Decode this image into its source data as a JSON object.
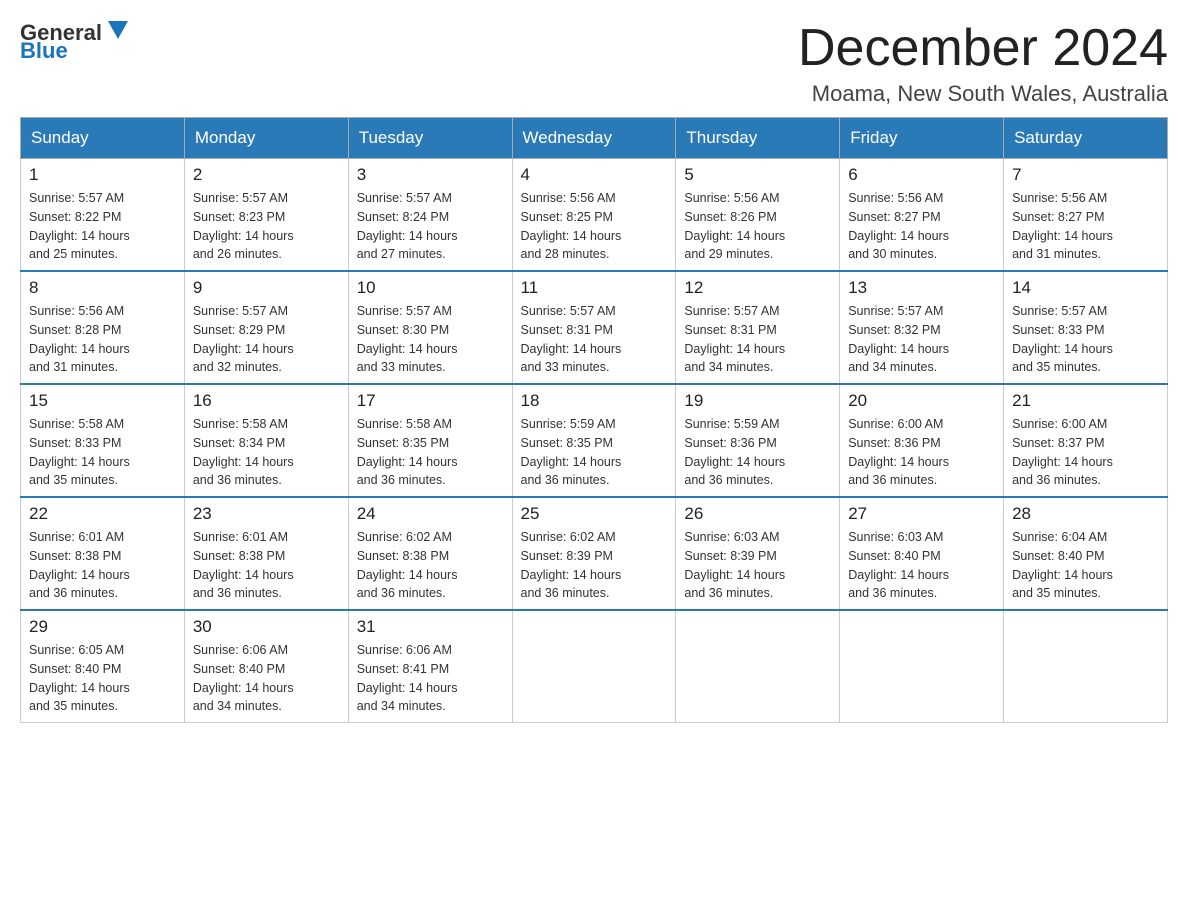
{
  "header": {
    "logo_general": "General",
    "logo_blue": "Blue",
    "month_title": "December 2024",
    "location": "Moama, New South Wales, Australia"
  },
  "days_of_week": [
    "Sunday",
    "Monday",
    "Tuesday",
    "Wednesday",
    "Thursday",
    "Friday",
    "Saturday"
  ],
  "weeks": [
    [
      {
        "day": "1",
        "sunrise": "5:57 AM",
        "sunset": "8:22 PM",
        "daylight": "14 hours and 25 minutes."
      },
      {
        "day": "2",
        "sunrise": "5:57 AM",
        "sunset": "8:23 PM",
        "daylight": "14 hours and 26 minutes."
      },
      {
        "day": "3",
        "sunrise": "5:57 AM",
        "sunset": "8:24 PM",
        "daylight": "14 hours and 27 minutes."
      },
      {
        "day": "4",
        "sunrise": "5:56 AM",
        "sunset": "8:25 PM",
        "daylight": "14 hours and 28 minutes."
      },
      {
        "day": "5",
        "sunrise": "5:56 AM",
        "sunset": "8:26 PM",
        "daylight": "14 hours and 29 minutes."
      },
      {
        "day": "6",
        "sunrise": "5:56 AM",
        "sunset": "8:27 PM",
        "daylight": "14 hours and 30 minutes."
      },
      {
        "day": "7",
        "sunrise": "5:56 AM",
        "sunset": "8:27 PM",
        "daylight": "14 hours and 31 minutes."
      }
    ],
    [
      {
        "day": "8",
        "sunrise": "5:56 AM",
        "sunset": "8:28 PM",
        "daylight": "14 hours and 31 minutes."
      },
      {
        "day": "9",
        "sunrise": "5:57 AM",
        "sunset": "8:29 PM",
        "daylight": "14 hours and 32 minutes."
      },
      {
        "day": "10",
        "sunrise": "5:57 AM",
        "sunset": "8:30 PM",
        "daylight": "14 hours and 33 minutes."
      },
      {
        "day": "11",
        "sunrise": "5:57 AM",
        "sunset": "8:31 PM",
        "daylight": "14 hours and 33 minutes."
      },
      {
        "day": "12",
        "sunrise": "5:57 AM",
        "sunset": "8:31 PM",
        "daylight": "14 hours and 34 minutes."
      },
      {
        "day": "13",
        "sunrise": "5:57 AM",
        "sunset": "8:32 PM",
        "daylight": "14 hours and 34 minutes."
      },
      {
        "day": "14",
        "sunrise": "5:57 AM",
        "sunset": "8:33 PM",
        "daylight": "14 hours and 35 minutes."
      }
    ],
    [
      {
        "day": "15",
        "sunrise": "5:58 AM",
        "sunset": "8:33 PM",
        "daylight": "14 hours and 35 minutes."
      },
      {
        "day": "16",
        "sunrise": "5:58 AM",
        "sunset": "8:34 PM",
        "daylight": "14 hours and 36 minutes."
      },
      {
        "day": "17",
        "sunrise": "5:58 AM",
        "sunset": "8:35 PM",
        "daylight": "14 hours and 36 minutes."
      },
      {
        "day": "18",
        "sunrise": "5:59 AM",
        "sunset": "8:35 PM",
        "daylight": "14 hours and 36 minutes."
      },
      {
        "day": "19",
        "sunrise": "5:59 AM",
        "sunset": "8:36 PM",
        "daylight": "14 hours and 36 minutes."
      },
      {
        "day": "20",
        "sunrise": "6:00 AM",
        "sunset": "8:36 PM",
        "daylight": "14 hours and 36 minutes."
      },
      {
        "day": "21",
        "sunrise": "6:00 AM",
        "sunset": "8:37 PM",
        "daylight": "14 hours and 36 minutes."
      }
    ],
    [
      {
        "day": "22",
        "sunrise": "6:01 AM",
        "sunset": "8:38 PM",
        "daylight": "14 hours and 36 minutes."
      },
      {
        "day": "23",
        "sunrise": "6:01 AM",
        "sunset": "8:38 PM",
        "daylight": "14 hours and 36 minutes."
      },
      {
        "day": "24",
        "sunrise": "6:02 AM",
        "sunset": "8:38 PM",
        "daylight": "14 hours and 36 minutes."
      },
      {
        "day": "25",
        "sunrise": "6:02 AM",
        "sunset": "8:39 PM",
        "daylight": "14 hours and 36 minutes."
      },
      {
        "day": "26",
        "sunrise": "6:03 AM",
        "sunset": "8:39 PM",
        "daylight": "14 hours and 36 minutes."
      },
      {
        "day": "27",
        "sunrise": "6:03 AM",
        "sunset": "8:40 PM",
        "daylight": "14 hours and 36 minutes."
      },
      {
        "day": "28",
        "sunrise": "6:04 AM",
        "sunset": "8:40 PM",
        "daylight": "14 hours and 35 minutes."
      }
    ],
    [
      {
        "day": "29",
        "sunrise": "6:05 AM",
        "sunset": "8:40 PM",
        "daylight": "14 hours and 35 minutes."
      },
      {
        "day": "30",
        "sunrise": "6:06 AM",
        "sunset": "8:40 PM",
        "daylight": "14 hours and 34 minutes."
      },
      {
        "day": "31",
        "sunrise": "6:06 AM",
        "sunset": "8:41 PM",
        "daylight": "14 hours and 34 minutes."
      },
      null,
      null,
      null,
      null
    ]
  ],
  "labels": {
    "sunrise": "Sunrise:",
    "sunset": "Sunset:",
    "daylight": "Daylight:"
  }
}
